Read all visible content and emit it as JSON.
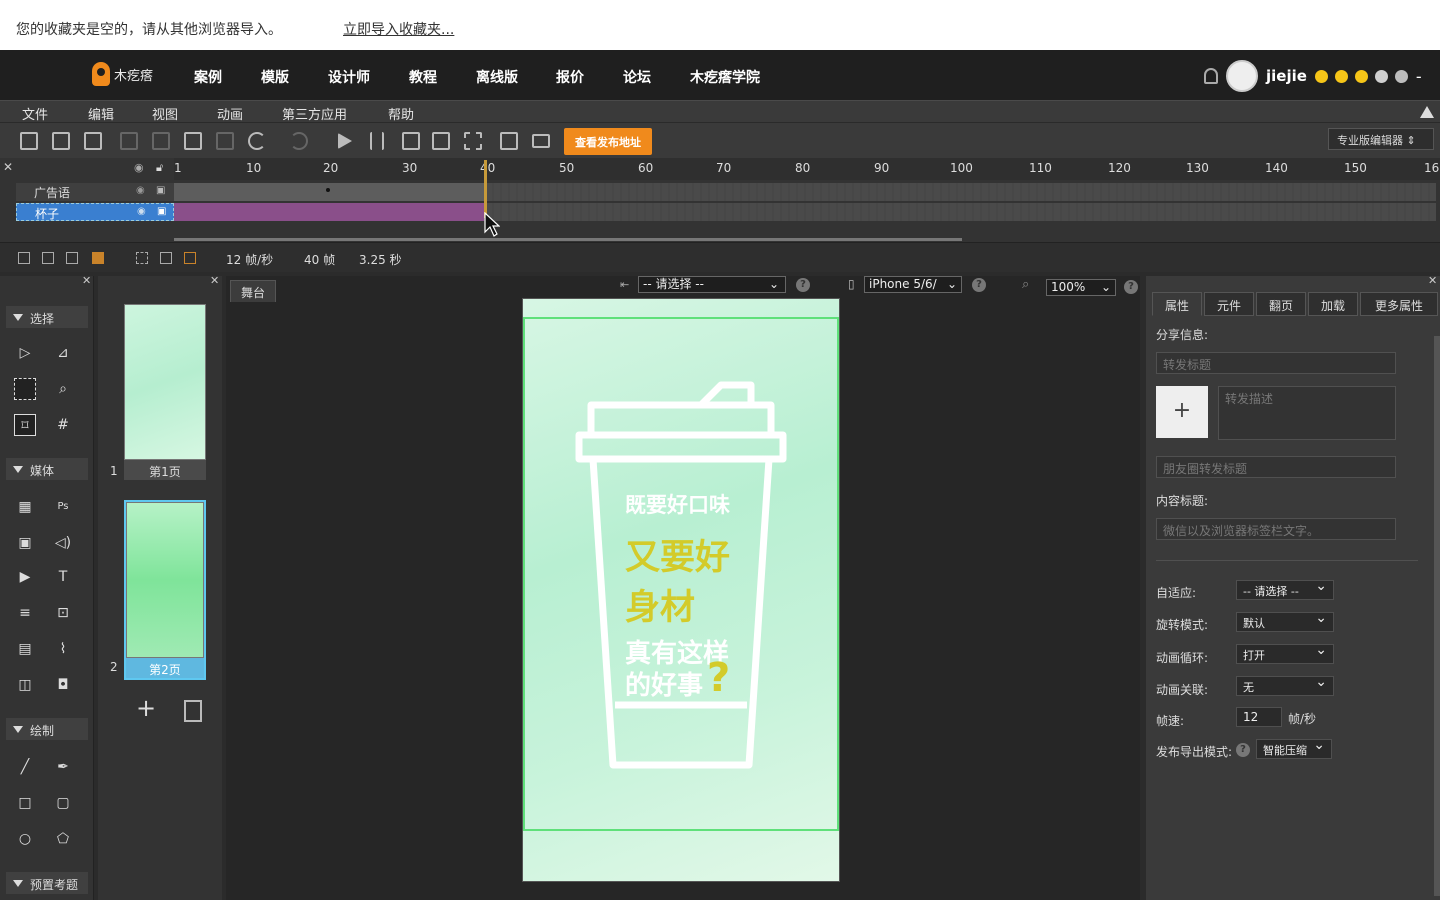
{
  "browser_bar": {
    "message": "您的收藏夹是空的，请从其他浏览器导入。",
    "import_link": "立即导入收藏夹..."
  },
  "topnav": {
    "logo_text": "木疙瘩",
    "links": [
      "案例",
      "模版",
      "设计师",
      "教程",
      "离线版",
      "报价",
      "论坛",
      "木疙瘩学院"
    ],
    "username": "jiejie",
    "dots": [
      "#f5c518",
      "#f5c518",
      "#f5c518",
      "#cfcfcf",
      "#bdbdbd"
    ],
    "dash": "-"
  },
  "menubar": [
    "文件",
    "编辑",
    "视图",
    "动画",
    "第三方应用",
    "帮助"
  ],
  "toolbar": {
    "publish_label": "查看发布地址",
    "edition_select": "专业版编辑器"
  },
  "timeline": {
    "ruler_ticks": [
      "1",
      "10",
      "20",
      "30",
      "40",
      "50",
      "60",
      "70",
      "80",
      "90",
      "100",
      "110",
      "120",
      "130",
      "140",
      "150",
      "16"
    ],
    "layers": [
      {
        "name": "广告语",
        "selected": false
      },
      {
        "name": "杯子",
        "selected": true
      }
    ],
    "status": {
      "fps": "12 帧/秒",
      "frames": "40 帧",
      "duration": "3.25 秒"
    }
  },
  "tools": {
    "sections": [
      "选择",
      "媒体",
      "绘制",
      "预置考题"
    ]
  },
  "pages": [
    {
      "number": "1",
      "label": "第1页"
    },
    {
      "number": "2",
      "label": "第2页"
    }
  ],
  "stage": {
    "tab_label": "舞台",
    "select_placeholder": "-- 请选择 --",
    "device": "iPhone 5/6/",
    "zoom": "100%",
    "cup_line1": "既要好口味",
    "cup_line2": "又要好",
    "cup_line3": "身材",
    "cup_line4": "真有这样",
    "cup_line5": "的好事",
    "cup_question": "?"
  },
  "props": {
    "tabs": [
      "属性",
      "元件",
      "翻页",
      "加载",
      "更多属性"
    ],
    "share_info_label": "分享信息:",
    "share_title_placeholder": "转发标题",
    "share_desc_placeholder": "转发描述",
    "moments_title_placeholder": "朋友圈转发标题",
    "content_title_label": "内容标题:",
    "content_title_placeholder": "微信以及浏览器标签栏文字。",
    "adapt_label": "自适应:",
    "adapt_value": "-- 请选择 --",
    "rotate_label": "旋转模式:",
    "rotate_value": "默认",
    "loop_label": "动画循环:",
    "loop_value": "打开",
    "link_label": "动画关联:",
    "link_value": "无",
    "fps_label": "帧速:",
    "fps_value": "12",
    "fps_unit": "帧/秒",
    "export_label": "发布导出模式:",
    "export_value": "智能压缩"
  }
}
